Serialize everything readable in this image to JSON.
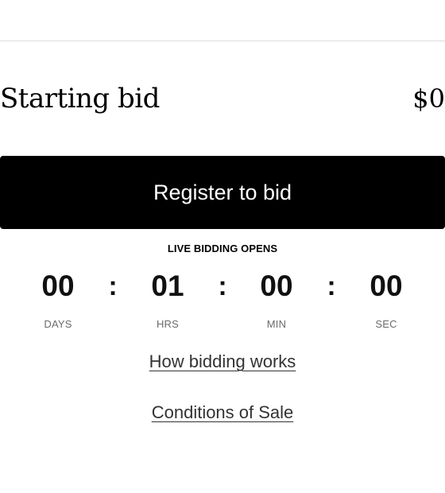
{
  "starting_bid": {
    "label": "Starting bid",
    "value": "$0"
  },
  "register_button": {
    "label": "Register to bid"
  },
  "live_bidding": {
    "label": "LIVE BIDDING OPENS"
  },
  "countdown": {
    "days": {
      "value": "00",
      "label": "DAYS"
    },
    "hours": {
      "value": "01",
      "label": "HRS"
    },
    "minutes": {
      "value": "00",
      "label": "MIN"
    },
    "seconds": {
      "value": "00",
      "label": "SEC"
    },
    "separator": ":"
  },
  "links": {
    "how_bidding_works": "How bidding works",
    "conditions_of_sale": "Conditions of Sale"
  },
  "colors": {
    "button_background": "#000000",
    "button_text": "#ffffff",
    "divider": "#dcdcdc",
    "unit_label": "#6b6b6b",
    "link_text": "#333333"
  }
}
